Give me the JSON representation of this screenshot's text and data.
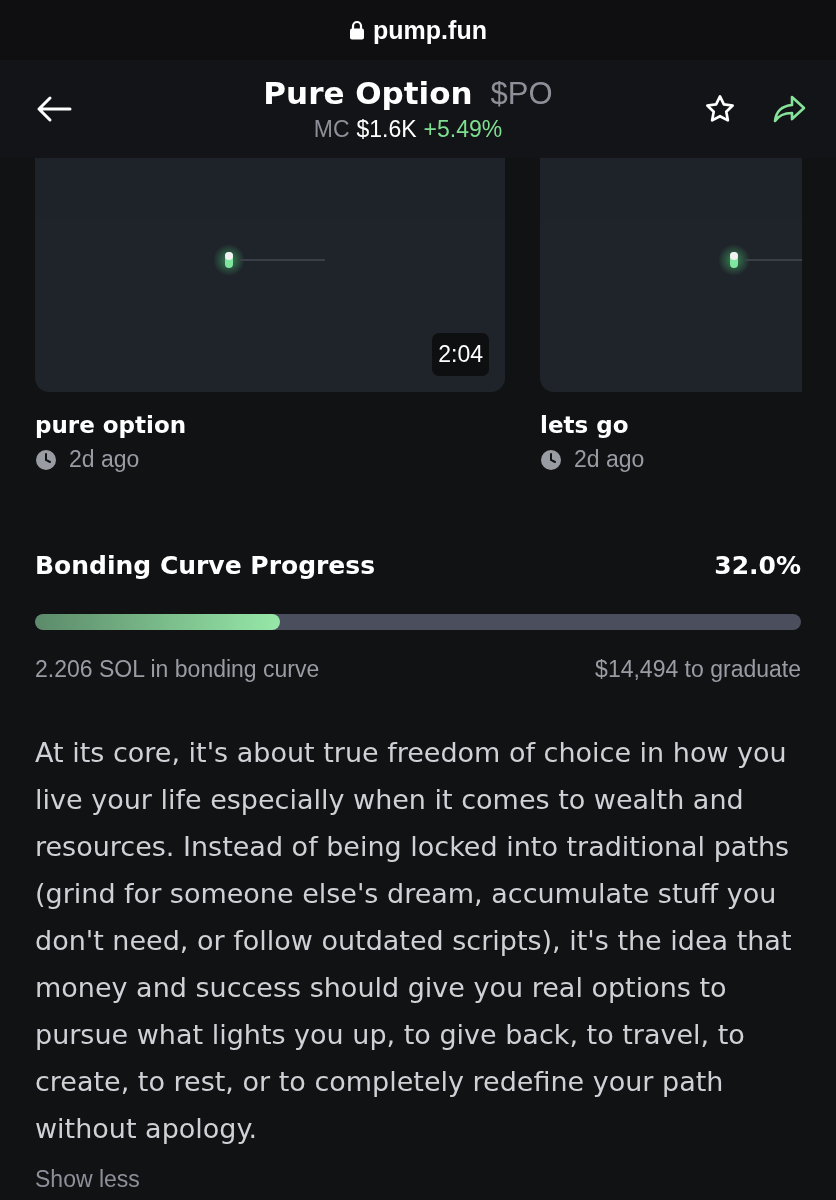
{
  "address_bar": {
    "url": "pump.fun"
  },
  "header": {
    "name": "Pure Option",
    "ticker": "$PO",
    "mc_label": "MC",
    "market_cap": "$1.6K",
    "change": "+5.49%"
  },
  "videos": [
    {
      "kind": "picture",
      "duration": "2:04",
      "title": "pure option",
      "time": "2d ago"
    },
    {
      "kind": "picture",
      "title": "lets go",
      "time": "2d ago"
    }
  ],
  "bonding_curve": {
    "title": "Bonding Curve Progress",
    "percent": "32.0%",
    "level": 0.32,
    "sol": "2.206 SOL in bonding curve",
    "to_graduate": "$14,494 to graduate"
  },
  "description": "At its core, it's about true freedom of choice in how you live your life especially when it comes to wealth and resources. Instead of being locked into traditional paths (grind for someone else's dream, accumulate stuff you don't need, or follow outdated scripts), it's the idea that money and success should give you real options to pursue what lights you up, to give back, to travel, to create, to rest, or to completely redefine your path without apology.",
  "show_less": "Show less"
}
